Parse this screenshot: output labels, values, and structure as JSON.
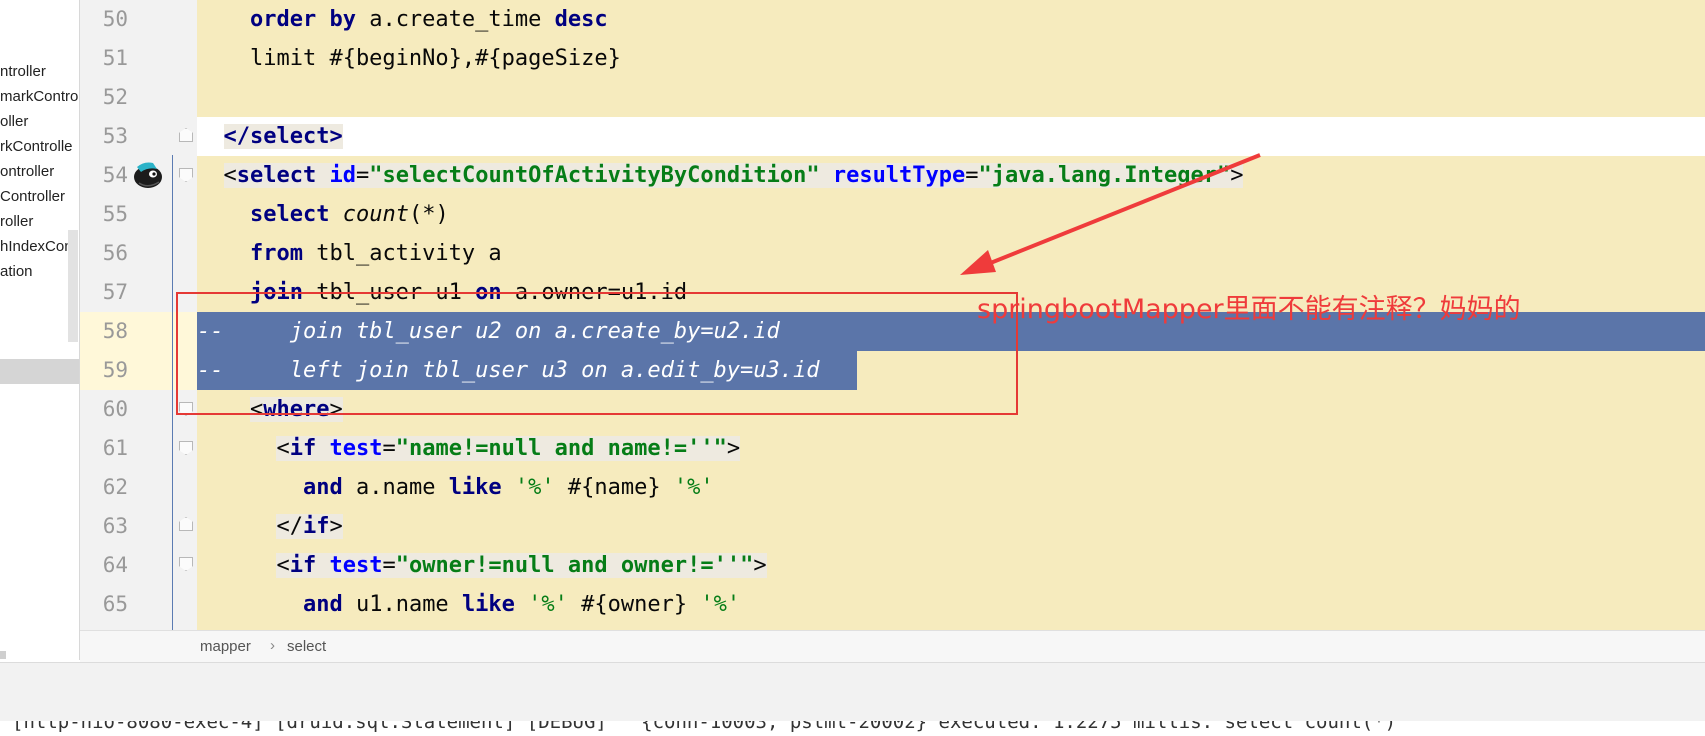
{
  "sidebar": {
    "items": [
      "ntroller",
      "markContro",
      "oller",
      "rkControlle",
      "ontroller",
      "Controller",
      "roller",
      "hIndexCon",
      "ation"
    ]
  },
  "editor": {
    "lines": [
      {
        "number": "50",
        "segments": [
          {
            "t": "    "
          },
          {
            "t": "order by",
            "c": "kw"
          },
          {
            "t": " a.create_time "
          },
          {
            "t": "desc",
            "c": "kw"
          }
        ]
      },
      {
        "number": "51",
        "segments": [
          {
            "t": "    limit #{beginNo},#{pageSize}"
          }
        ]
      },
      {
        "number": "52",
        "segments": [
          {
            "t": ""
          }
        ]
      },
      {
        "number": "53",
        "segments": [
          {
            "t": "  "
          },
          {
            "t": "</",
            "c": "kw tag-bg"
          },
          {
            "t": "select",
            "c": "kw tag-bg"
          },
          {
            "t": ">",
            "c": "kw tag-bg"
          }
        ]
      },
      {
        "number": "54",
        "segments": [
          {
            "t": "  "
          },
          {
            "t": "<",
            "c": "tag-bg"
          },
          {
            "t": "select",
            "c": "kw tag-bg"
          },
          {
            "t": " ",
            "c": "tag-bg"
          },
          {
            "t": "id",
            "c": "attr tag-bg"
          },
          {
            "t": "=",
            "c": "tag-bg"
          },
          {
            "t": "\"selectCountOfActivityByCondition\"",
            "c": "str tag-bg"
          },
          {
            "t": " ",
            "c": "tag-bg"
          },
          {
            "t": "resultType",
            "c": "attr tag-bg"
          },
          {
            "t": "=",
            "c": "tag-bg"
          },
          {
            "t": "\"java.lang.Integer\"",
            "c": "str tag-bg"
          },
          {
            "t": ">",
            "c": "tag-bg"
          }
        ]
      },
      {
        "number": "55",
        "segments": [
          {
            "t": "    "
          },
          {
            "t": "select",
            "c": "kw"
          },
          {
            "t": " "
          },
          {
            "t": "count",
            "c": "italic"
          },
          {
            "t": "(*)"
          }
        ]
      },
      {
        "number": "56",
        "segments": [
          {
            "t": "    "
          },
          {
            "t": "from",
            "c": "kw"
          },
          {
            "t": " tbl_activity a"
          }
        ]
      },
      {
        "number": "57",
        "segments": [
          {
            "t": "    "
          },
          {
            "t": "join",
            "c": "kw"
          },
          {
            "t": " tbl_user u1 "
          },
          {
            "t": "on",
            "c": "kw"
          },
          {
            "t": " a.owner=u1.id"
          }
        ]
      },
      {
        "number": "58",
        "segments": [
          {
            "t": "--     join tbl_user u2 on a.create_by=u2.id",
            "c": "sel-text"
          }
        ]
      },
      {
        "number": "59",
        "segments": [
          {
            "t": "--     left join tbl_user u3 on a.edit_by=u3.id",
            "c": "sel-text"
          }
        ]
      },
      {
        "number": "60",
        "segments": [
          {
            "t": "    "
          },
          {
            "t": "<",
            "c": "tag-bg"
          },
          {
            "t": "where",
            "c": "kw tag-bg"
          },
          {
            "t": ">",
            "c": "tag-bg"
          }
        ]
      },
      {
        "number": "61",
        "segments": [
          {
            "t": "      "
          },
          {
            "t": "<",
            "c": "tag-bg"
          },
          {
            "t": "if",
            "c": "kw tag-bg"
          },
          {
            "t": " ",
            "c": "tag-bg"
          },
          {
            "t": "test",
            "c": "attr tag-bg"
          },
          {
            "t": "=",
            "c": "tag-bg"
          },
          {
            "t": "\"name!=null and name!=''\"",
            "c": "str tag-bg"
          },
          {
            "t": ">",
            "c": "tag-bg"
          }
        ]
      },
      {
        "number": "62",
        "segments": [
          {
            "t": "        "
          },
          {
            "t": "and",
            "c": "kw"
          },
          {
            "t": " a.name "
          },
          {
            "t": "like",
            "c": "kw"
          },
          {
            "t": " "
          },
          {
            "t": "'%'",
            "c": "sqlstr"
          },
          {
            "t": " #{name} "
          },
          {
            "t": "'%'",
            "c": "sqlstr"
          }
        ]
      },
      {
        "number": "63",
        "segments": [
          {
            "t": "      "
          },
          {
            "t": "</",
            "c": "tag-bg"
          },
          {
            "t": "if",
            "c": "kw tag-bg"
          },
          {
            "t": ">",
            "c": "tag-bg"
          }
        ]
      },
      {
        "number": "64",
        "segments": [
          {
            "t": "      "
          },
          {
            "t": "<",
            "c": "tag-bg"
          },
          {
            "t": "if",
            "c": "kw tag-bg"
          },
          {
            "t": " ",
            "c": "tag-bg"
          },
          {
            "t": "test",
            "c": "attr tag-bg"
          },
          {
            "t": "=",
            "c": "tag-bg"
          },
          {
            "t": "\"owner!=null and owner!=''\"",
            "c": "str tag-bg"
          },
          {
            "t": ">",
            "c": "tag-bg"
          }
        ]
      },
      {
        "number": "65",
        "segments": [
          {
            "t": "        "
          },
          {
            "t": "and",
            "c": "kw"
          },
          {
            "t": " u1.name "
          },
          {
            "t": "like",
            "c": "kw"
          },
          {
            "t": " "
          },
          {
            "t": "'%'",
            "c": "sqlstr"
          },
          {
            "t": " #{owner} "
          },
          {
            "t": "'%'",
            "c": "sqlstr"
          }
        ]
      }
    ]
  },
  "annotation": {
    "text": "springbootMapper里面不能有注释？妈妈的",
    "color": "#ef3b3b"
  },
  "breadcrumb": {
    "items": [
      "mapper",
      "select"
    ],
    "separator": "›"
  },
  "console": {
    "text": "[http-nio-8080-exec-4] [druid.sql.Statement] [DEBUG]   {conn-10003, pstmt-20002} executed. 1.2275 millis. select count(*)"
  },
  "colors": {
    "editor_bg": "#f6ebbe",
    "selection": "#5b75a9",
    "keyword": "#000080",
    "attribute": "#0000ff",
    "string": "#067d17"
  },
  "icons": {
    "gutter_marker": "mascot-icon"
  }
}
